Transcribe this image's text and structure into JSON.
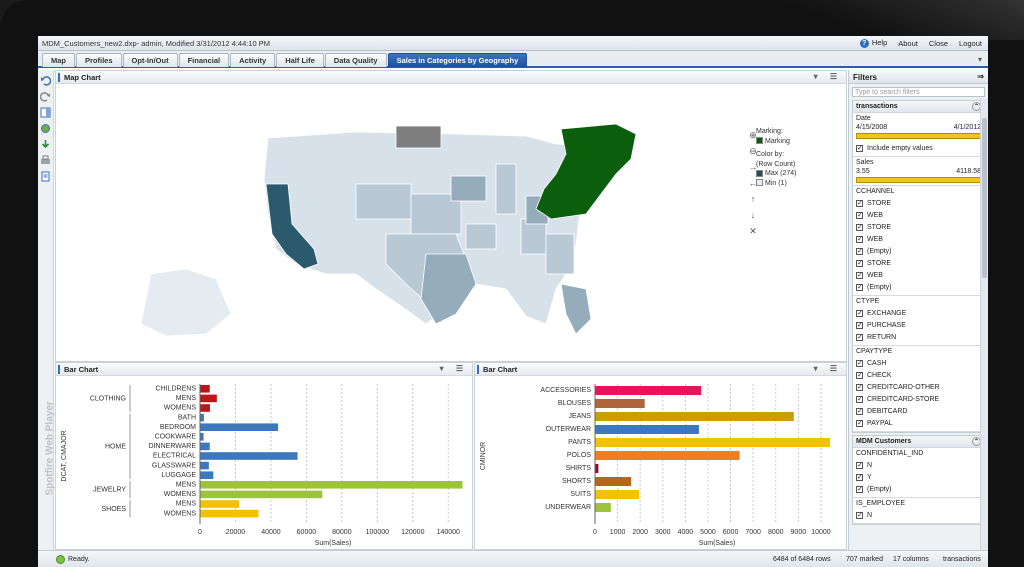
{
  "window": {
    "document_title": "MDM_Customers_new2.dxp- admin, Modified 3/31/2012 4:44:10 PM",
    "links": [
      "Help",
      "About",
      "Close",
      "Logout"
    ]
  },
  "tabs": [
    "Map",
    "Profiles",
    "Opt-In/Out",
    "Financial",
    "Activity",
    "Half Life",
    "Data Quality",
    "Sales in Categories by Geography"
  ],
  "active_tab": "Sales in Categories by Geography",
  "watermark": "Spotfire Web Player",
  "map_panel": {
    "title": "Map Chart",
    "legend": {
      "marking_label": "Marking:",
      "marking_item": "Marking",
      "color_by_label": "Color by:",
      "color_by_value": "(Row Count)",
      "max_label": "Max (274)",
      "min_label": "Min (1)"
    },
    "colors": {
      "marked": "#0b5e0b",
      "high": "#2b5a6d",
      "mid": "#9fb3c1",
      "low": "#d7e1ea",
      "na": "#7f7f7f"
    }
  },
  "bar_chart_left": {
    "title": "Bar Chart",
    "y_axis_label": "DCAT, CMAJOR",
    "x_axis_label": "Sum(Sales)",
    "chart_data": {
      "type": "bar",
      "orientation": "horizontal",
      "groups": [
        {
          "name": "CLOTHING",
          "categories": [
            "CHILDRENS",
            "MENS",
            "WOMENS"
          ],
          "values": [
            5500,
            9500,
            5600
          ],
          "color": "#c0141b"
        },
        {
          "name": "HOME",
          "categories": [
            "BATH",
            "BEDROOM",
            "COOKWARE",
            "DINNERWARE",
            "ELECTRICAL",
            "GLASSWARE",
            "LUGGAGE"
          ],
          "values": [
            2200,
            44000,
            2000,
            5500,
            55000,
            5000,
            7500
          ],
          "color": "#3b78bd"
        },
        {
          "name": "JEWELRY",
          "categories": [
            "MENS",
            "WOMENS"
          ],
          "values": [
            148000,
            69000
          ],
          "color": "#9cc33a"
        },
        {
          "name": "SHOES",
          "categories": [
            "MENS",
            "WOMENS"
          ],
          "values": [
            22000,
            33000
          ],
          "color": "#f2c200"
        }
      ],
      "ticks": [
        "0",
        "20000",
        "40000",
        "60000",
        "80000",
        "100000",
        "120000",
        "140000"
      ],
      "xlim": [
        0,
        150000
      ]
    }
  },
  "bar_chart_right": {
    "title": "Bar Chart",
    "y_axis_label": "CMINOR",
    "x_axis_label": "Sum(Sales)",
    "chart_data": {
      "type": "bar",
      "orientation": "horizontal",
      "categories": [
        "ACCESSORIES",
        "BLOUSES",
        "JEANS",
        "OUTERWEAR",
        "PANTS",
        "POLOS",
        "SHIRTS",
        "SHORTS",
        "SUITS",
        "UNDERWEAR"
      ],
      "values": [
        4700,
        2200,
        8800,
        4600,
        10400,
        6400,
        150,
        1600,
        1950,
        700
      ],
      "colors": [
        "#e8145b",
        "#b0643a",
        "#c9a000",
        "#3b78bd",
        "#f2c200",
        "#f07d1f",
        "#8b0f2a",
        "#b8651a",
        "#f2c200",
        "#9cc33a"
      ],
      "ticks": [
        "0",
        "1000",
        "2000",
        "3000",
        "4000",
        "5000",
        "6000",
        "7000",
        "8000",
        "9000",
        "10000"
      ],
      "xlim": [
        0,
        10800
      ]
    }
  },
  "filters": {
    "title": "Filters",
    "search_placeholder": "Type to search filters",
    "groups": [
      {
        "title": "transactions",
        "date_label": "Date",
        "date_from": "4/15/2008",
        "date_to": "4/1/2012",
        "include_empty": "Include empty values",
        "sales_label": "Sales",
        "sales_from": "3.55",
        "sales_to": "4118.58",
        "lists": [
          {
            "label": "CCHANNEL",
            "items": [
              "STORE",
              "WEB",
              "STORE",
              "WEB",
              "(Empty)",
              "STORE",
              "WEB",
              "(Empty)"
            ]
          },
          {
            "label": "CTYPE",
            "items": [
              "EXCHANGE",
              "PURCHASE",
              "RETURN"
            ]
          },
          {
            "label": "CPAYTYPE",
            "items": [
              "CASH",
              "CHECK",
              "CREDITCARD-OTHER",
              "CREDITCARD-STORE",
              "DEBITCARD",
              "PAYPAL"
            ]
          }
        ]
      },
      {
        "title": "MDM Customers",
        "lists": [
          {
            "label": "CONFIDENTIAL_IND",
            "items": [
              "N",
              "Y",
              "(Empty)"
            ]
          },
          {
            "label": "IS_EMPLOYEE",
            "items": [
              "N"
            ]
          }
        ]
      }
    ]
  },
  "status": {
    "ready": "Ready.",
    "rows": "6484 of 6484 rows",
    "marked": "707 marked",
    "columns": "17 columns",
    "table": "transactions"
  }
}
